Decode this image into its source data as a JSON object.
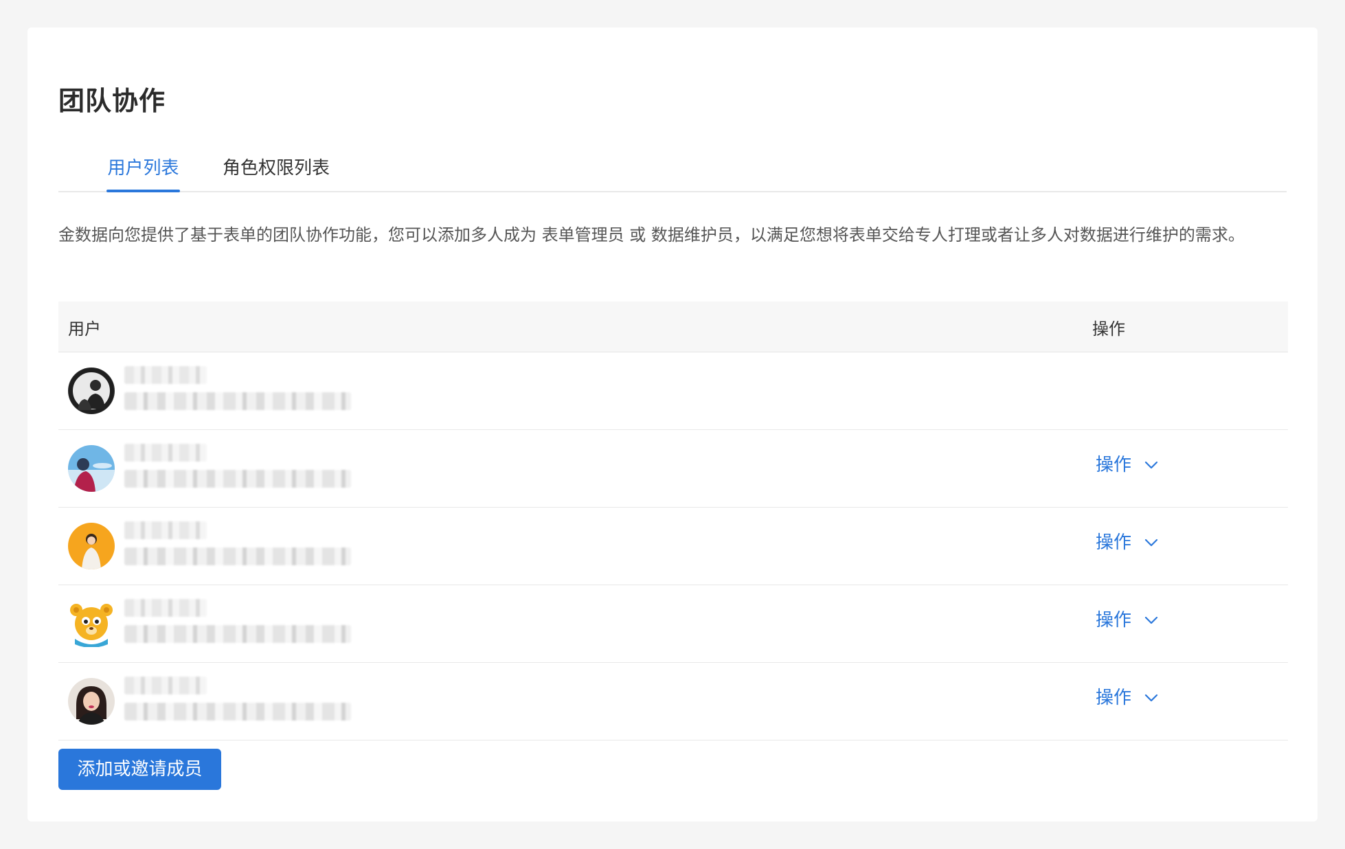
{
  "page": {
    "title": "团队协作"
  },
  "tabs": [
    {
      "label": "用户列表",
      "active": true
    },
    {
      "label": "角色权限列表",
      "active": false
    }
  ],
  "description": "金数据向您提供了基于表单的团队协作功能，您可以添加多人成为 表单管理员 或 数据维护员，以满足您想将表单交给专人打理或者让多人对数据进行维护的需求。",
  "table": {
    "columns": [
      "用户",
      "操作"
    ],
    "rows": [
      {
        "avatar_icon": "portrait-man-avatar",
        "has_action": false,
        "action_label": ""
      },
      {
        "avatar_icon": "portrait-sky-avatar",
        "has_action": true,
        "action_label": "操作"
      },
      {
        "avatar_icon": "portrait-woman-orange-avatar",
        "has_action": true,
        "action_label": "操作"
      },
      {
        "avatar_icon": "bear-avatar",
        "has_action": true,
        "action_label": "操作"
      },
      {
        "avatar_icon": "portrait-woman-avatar",
        "has_action": true,
        "action_label": "操作"
      }
    ]
  },
  "actions": {
    "add_member_label": "添加或邀请成员"
  },
  "colors": {
    "accent": "#2a77db",
    "background": "#f5f5f5",
    "card": "#ffffff",
    "table_header_bg": "#f7f7f7"
  }
}
